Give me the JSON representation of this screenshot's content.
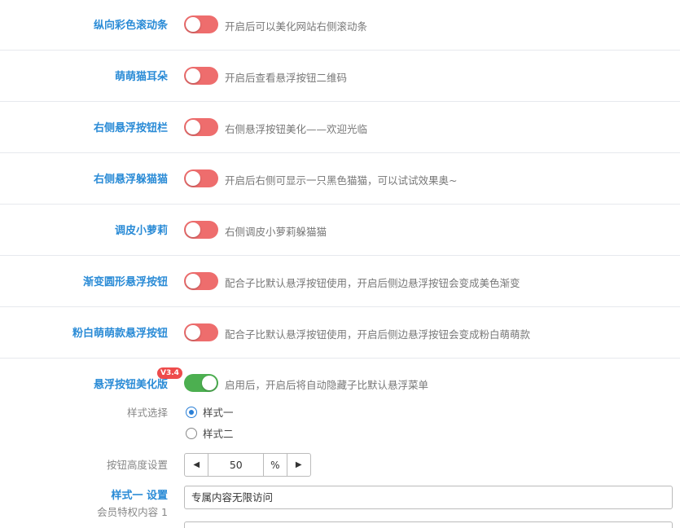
{
  "settings": [
    {
      "label": "纵向彩色滚动条",
      "enabled": false,
      "description": "开启后可以美化网站右侧滚动条"
    },
    {
      "label": "萌萌猫耳朵",
      "enabled": false,
      "description": "开启后查看悬浮按钮二维码"
    },
    {
      "label": "右侧悬浮按钮栏",
      "enabled": false,
      "description": "右侧悬浮按钮美化——欢迎光临"
    },
    {
      "label": "右侧悬浮躲猫猫",
      "enabled": false,
      "description": "开启后右侧可显示一只黑色猫猫，可以试试效果奥~"
    },
    {
      "label": "调皮小萝莉",
      "enabled": false,
      "description": "右侧调皮小萝莉躲猫猫"
    },
    {
      "label": "渐变圆形悬浮按钮",
      "enabled": false,
      "description": "配合子比默认悬浮按钮使用，开启后侧边悬浮按钮会变成美色渐变"
    },
    {
      "label": "粉白萌萌款悬浮按钮",
      "enabled": false,
      "description": "配合子比默认悬浮按钮使用，开启后侧边悬浮按钮会变成粉白萌萌款"
    }
  ],
  "float_beauty": {
    "label": "悬浮按钮美化版",
    "badge": "V3.4",
    "enabled": true,
    "description": "启用后，开启后将自动隐藏子比默认悬浮菜单",
    "style_select_label": "样式选择",
    "style_options": [
      "样式一",
      "样式二"
    ],
    "selected_style": "样式一",
    "height_label": "按钮高度设置",
    "height_value": "50",
    "height_unit": "%",
    "style_one_label": "样式一 设置",
    "vip_content_label": "会员特权内容 1",
    "vip_content_value": "专属内容无限访问"
  },
  "colors": {
    "label_blue": "#2a8bd6",
    "toggle_off": "#ee6d6d",
    "toggle_on": "#4caf50",
    "badge_red": "#ee4b4b"
  },
  "icons": {
    "decrement": "triangle-left",
    "increment": "triangle-right"
  }
}
